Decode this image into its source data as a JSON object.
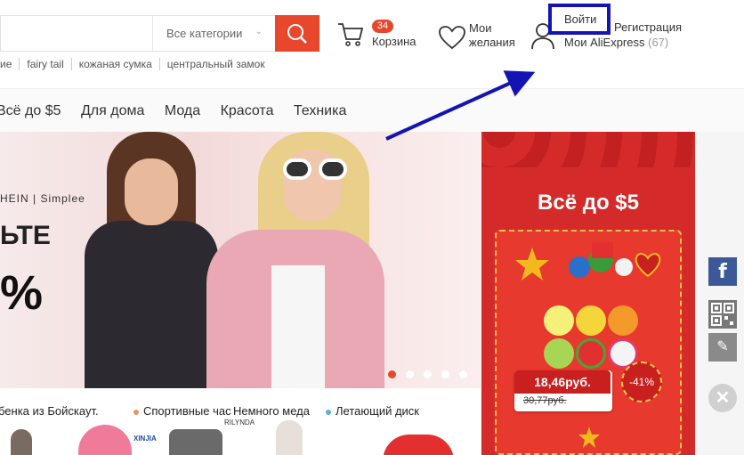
{
  "search": {
    "placeholder": "",
    "category": "Все категории"
  },
  "hot_searches": [
    "ие",
    "fairy tail",
    "кожаная сумка",
    "центральный замок"
  ],
  "cart": {
    "count": "34",
    "label": "Корзина"
  },
  "wishlist": {
    "line1": "Мои",
    "line2": "желания"
  },
  "account": {
    "login": "Войти",
    "register": "Регистрация",
    "my_aliexpress": "Мои AliExpress",
    "count": "(67)"
  },
  "nav": [
    "Всё до $5",
    "Для дома",
    "Мода",
    "Красота",
    "Техника"
  ],
  "banner": {
    "brand": "HEIN | Simplee",
    "text1": "ЬТЕ",
    "text2": "%"
  },
  "promo": {
    "title": "Всё до $5",
    "price_new": "18,46руб.",
    "price_old": "30,77руб.",
    "discount": "-41%"
  },
  "bottom_items": [
    {
      "label": "бенка из Бойскаут.",
      "color": "#e8472c"
    },
    {
      "label": "Спортивные час",
      "color": "#e8472c"
    },
    {
      "label": "Немного меда",
      "color": "#e8472c"
    },
    {
      "label": "Летающий диск",
      "color": "#5aaee0"
    }
  ],
  "brand_logos": [
    "XINJIA",
    "RILYNDA"
  ],
  "colors": {
    "accent": "#e8472c",
    "promo_red": "#d42a2a",
    "highlight_box": "#1414b4",
    "facebook": "#3b5998"
  }
}
